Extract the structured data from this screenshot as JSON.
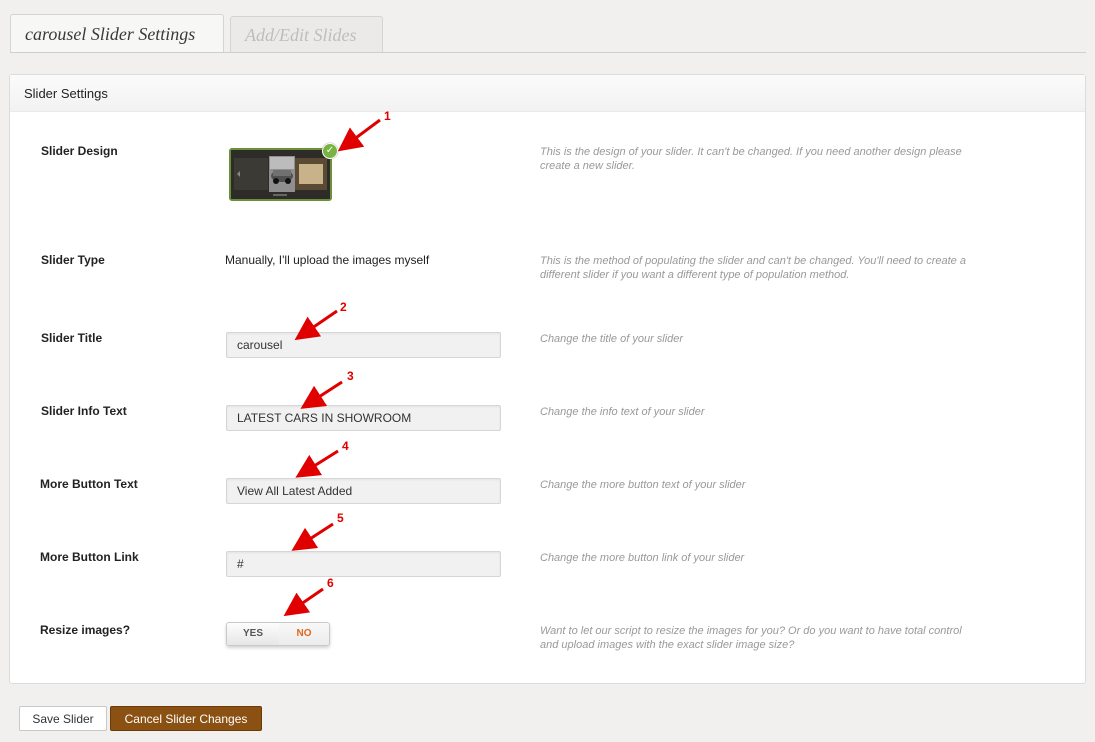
{
  "tabs": [
    {
      "label": "carousel Slider Settings",
      "active": true
    },
    {
      "label": "Add/Edit Slides",
      "active": false
    }
  ],
  "panel": {
    "title": "Slider Settings"
  },
  "rows": {
    "design": {
      "label": "Slider Design",
      "desc": "This is the design of your slider. It can't be changed. If you need another design please create a new slider."
    },
    "type": {
      "label": "Slider Type",
      "value": "Manually, I'll upload the images myself",
      "desc": "This is the method of populating the slider and can't be changed. You'll need to create a different slider if you want a different type of population method."
    },
    "title": {
      "label": "Slider Title",
      "value": "carousel",
      "desc": "Change the title of your slider"
    },
    "info": {
      "label": "Slider Info Text",
      "value": "LATEST CARS IN SHOWROOM",
      "desc": "Change the info text of your slider"
    },
    "more_text": {
      "label": "More Button Text",
      "value": "View All Latest Added",
      "desc": "Change the more button text of your slider"
    },
    "more_link": {
      "label": "More Button Link",
      "value": "#",
      "desc": "Change the more button link of your slider"
    },
    "resize": {
      "label": "Resize images?",
      "yes": "YES",
      "no": "NO",
      "selected": "NO",
      "desc": "Want to let our script to resize the images for you? Or do you want to have total control and upload images with the exact slider image size?"
    }
  },
  "annotations": [
    "1",
    "2",
    "3",
    "4",
    "5",
    "6"
  ],
  "buttons": {
    "save": "Save Slider",
    "cancel": "Cancel Slider Changes"
  },
  "colors": {
    "accent_brown": "#8a5113",
    "annotation_red": "#e00000",
    "selected_green": "#79b443",
    "toggle_no": "#e0671f"
  },
  "icons": {
    "design_selected": "check-icon"
  }
}
